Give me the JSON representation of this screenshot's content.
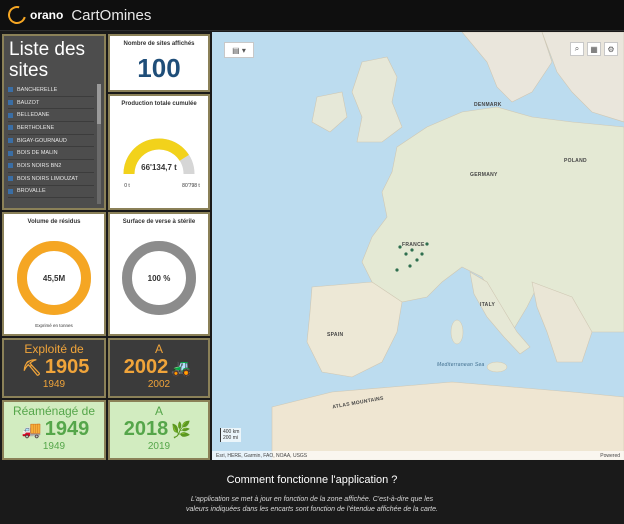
{
  "header": {
    "brand": "orano",
    "app_name": "CartOmines"
  },
  "sites_panel": {
    "title": "Liste des sites",
    "items": [
      "BANCHERELLE",
      "BAUZOT",
      "BELLEDANE",
      "BERTHOLENE",
      "BIGAY-GOURNAUD",
      "BOIS DE MALIN",
      "BOIS NOIRS BN2",
      "BOIS NOIRS LIMOUZAT",
      "BROVALLE"
    ]
  },
  "count_card": {
    "title": "Nombre de sites affichés",
    "value": "100"
  },
  "production_card": {
    "title": "Production totale cumulée",
    "value": "66'134,7 t",
    "min": "0 t",
    "max": "80'798 t",
    "fill_fraction": 0.819,
    "fill_color": "#f2d21b"
  },
  "residus_card": {
    "title": "Volume de résidus",
    "value": "45,5M",
    "note": "Exprimé en tonnes",
    "fill_fraction": 1.0,
    "fill_color": "#f5a623"
  },
  "surface_card": {
    "title": "Surface de verse à stérile",
    "value": "100 %",
    "fill_fraction": 1.0,
    "fill_color": "#8c8c8c"
  },
  "exploite": {
    "title": "Exploité de",
    "value": "1905",
    "sub": "1949",
    "icon": "pickaxe-icon"
  },
  "exploite_a": {
    "title": "A",
    "value": "2002",
    "sub": "2002",
    "icon": "excavator-icon"
  },
  "reamenage": {
    "title": "Réaménagé de",
    "value": "1949",
    "sub": "1949",
    "icon": "truck-icon"
  },
  "reamenage_a": {
    "title": "A",
    "value": "2018",
    "sub": "2019",
    "icon": "leaf-icon"
  },
  "map": {
    "scale_top": "400 km",
    "scale_bottom": "200 mi",
    "attribution_left": "Esri, HERE, Garmin, FAO, NOAA, USGS",
    "attribution_right": "Powered",
    "labels": {
      "denmark": "DENMARK",
      "poland": "POLAND",
      "germany": "GERMANY",
      "france": "FRANCE",
      "spain": "SPAIN",
      "italy": "ITALY",
      "atlas": "ATLAS MOUNTAINS",
      "med": "Mediterranean Sea"
    }
  },
  "footer": {
    "title": "Comment fonctionne l'application ?",
    "text_line1": "L'application se met à jour en fonction de la zone affichée. C'est-à-dire que les",
    "text_line2": "valeurs indiquées dans les encarts sont fonction de l'étendue affichée de la carte."
  }
}
